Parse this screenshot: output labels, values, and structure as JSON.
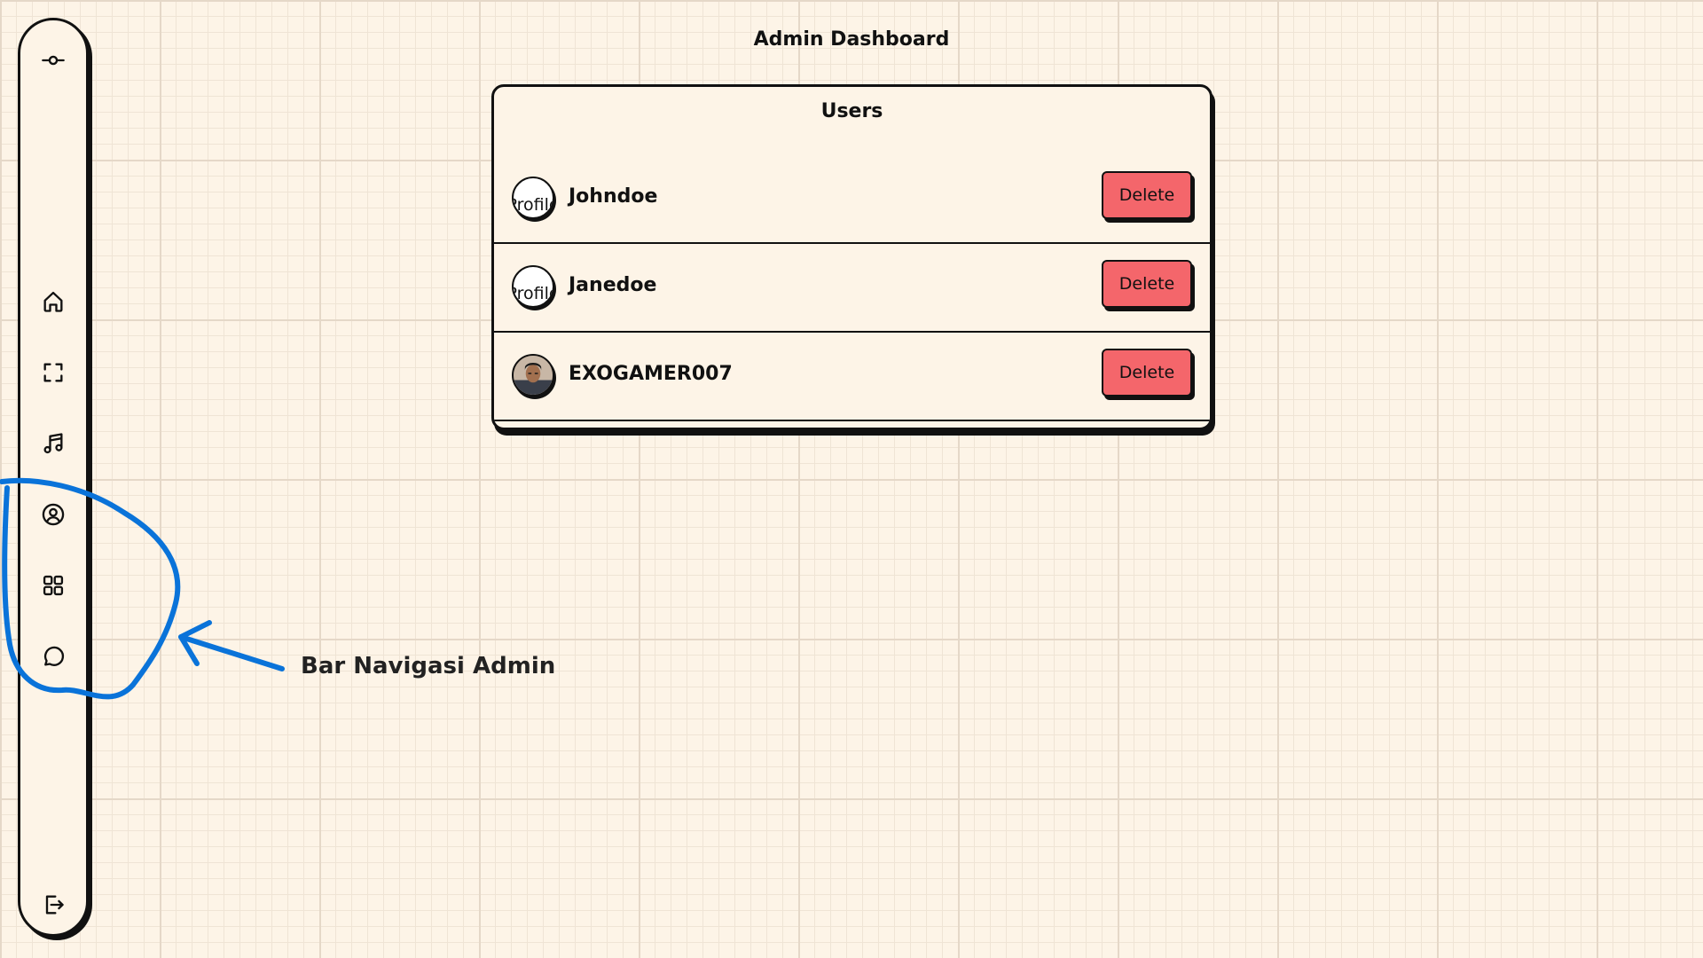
{
  "page": {
    "title": "Admin Dashboard"
  },
  "sidebar": {
    "top_icon": "commit-icon",
    "items": [
      {
        "name": "home",
        "icon": "home-icon"
      },
      {
        "name": "fullscreen",
        "icon": "expand-icon"
      },
      {
        "name": "music",
        "icon": "music-note-icon"
      },
      {
        "name": "profile",
        "icon": "user-circle-icon"
      },
      {
        "name": "grid",
        "icon": "grid-icon"
      },
      {
        "name": "chat",
        "icon": "chat-bubble-icon"
      }
    ],
    "bottom_icon": "logout-icon"
  },
  "users_card": {
    "title": "Users",
    "rows": [
      {
        "username": "Johndoe",
        "avatar_alt": "Profile",
        "delete_label": "Delete"
      },
      {
        "username": "Janedoe",
        "avatar_alt": "Profile",
        "delete_label": "Delete"
      },
      {
        "username": "EXOGAMER007",
        "avatar_alt": "",
        "delete_label": "Delete"
      }
    ]
  },
  "annotation": {
    "label": "Bar Navigasi Admin",
    "color": "#0a73d9"
  },
  "colors": {
    "background": "#fdf4e7",
    "delete_button": "#f4666b",
    "border": "#111111"
  }
}
